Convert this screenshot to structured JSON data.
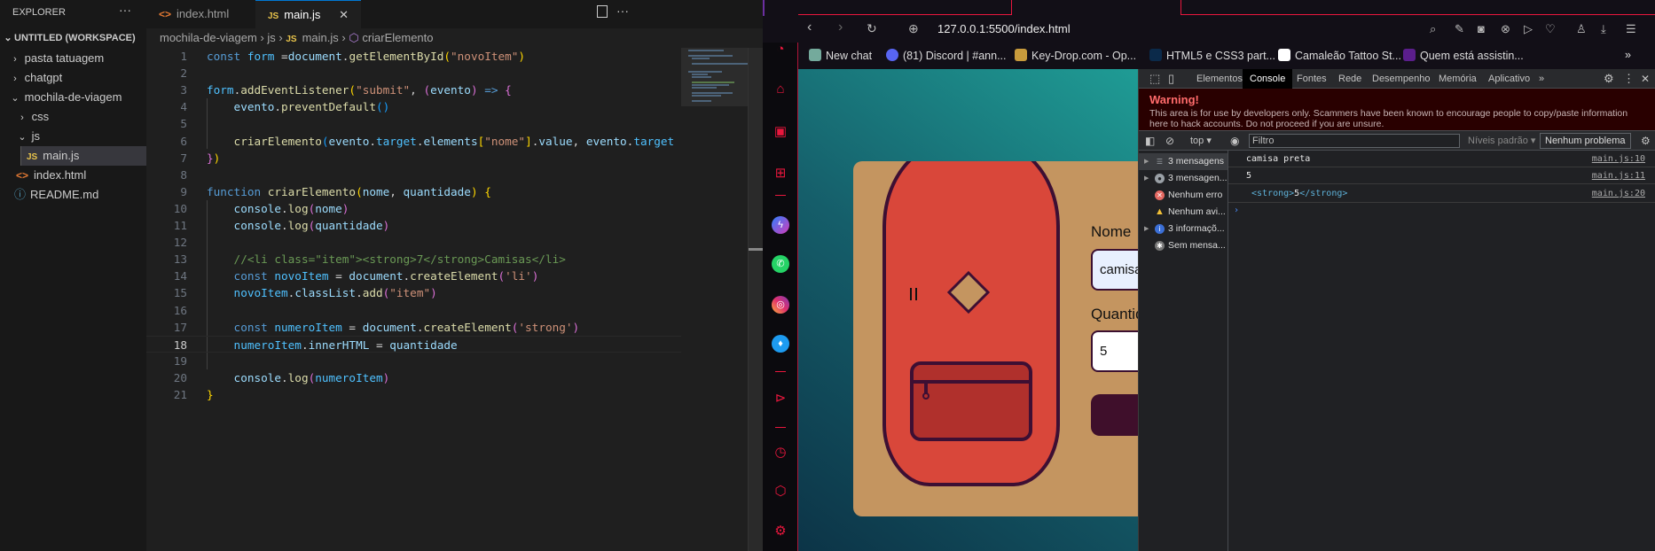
{
  "vscode": {
    "explorer": {
      "title": "EXPLORER",
      "more": "···",
      "workspace": "UNTITLED (WORKSPACE)",
      "items": [
        {
          "label": "pasta tatuagem",
          "chev": "›"
        },
        {
          "label": "chatgpt",
          "chev": "›"
        },
        {
          "label": "mochila-de-viagem",
          "chev": "⌄"
        },
        {
          "label": "css",
          "chev": "›"
        },
        {
          "label": "js",
          "chev": "⌄"
        },
        {
          "label": "main.js",
          "icon": "JS"
        },
        {
          "label": "index.html",
          "icon": "<>"
        },
        {
          "label": "README.md",
          "icon": "ⓘ"
        }
      ]
    },
    "tabs": [
      {
        "label": "index.html",
        "icon": "<>"
      },
      {
        "label": "main.js",
        "icon": "JS",
        "close": "✕"
      }
    ],
    "breadcrumb": [
      "mochila-de-viagem",
      "js",
      "main.js",
      "criarElemento"
    ],
    "current_line": 18,
    "code": [
      {
        "n": "1",
        "tokens": [
          [
            "const ",
            "k"
          ],
          [
            "form",
            "v2"
          ],
          [
            " =",
            "p"
          ],
          [
            "document",
            "v"
          ],
          [
            ".",
            "p"
          ],
          [
            "getElementById",
            "f"
          ],
          [
            "(",
            "b1"
          ],
          [
            "\"novoItem\"",
            "s"
          ],
          [
            ")",
            "b1"
          ]
        ]
      },
      {
        "n": "2",
        "tokens": []
      },
      {
        "n": "3",
        "tokens": [
          [
            "form",
            "v2"
          ],
          [
            ".",
            "p"
          ],
          [
            "addEventListener",
            "f"
          ],
          [
            "(",
            "b1"
          ],
          [
            "\"submit\"",
            "s"
          ],
          [
            ", ",
            "p"
          ],
          [
            "(",
            "b2"
          ],
          [
            "evento",
            "v"
          ],
          [
            ")",
            "b2"
          ],
          [
            " => ",
            "k"
          ],
          [
            "{",
            "b2"
          ]
        ]
      },
      {
        "n": "4",
        "tokens": [
          [
            "    evento",
            "v"
          ],
          [
            ".",
            "p"
          ],
          [
            "preventDefault",
            "f"
          ],
          [
            "()",
            "b3"
          ]
        ]
      },
      {
        "n": "5",
        "tokens": []
      },
      {
        "n": "6",
        "tokens": [
          [
            "    criarElemento",
            "f"
          ],
          [
            "(",
            "b3"
          ],
          [
            "evento",
            "v"
          ],
          [
            ".",
            "p"
          ],
          [
            "target",
            "v2"
          ],
          [
            ".",
            "p"
          ],
          [
            "elements",
            "v"
          ],
          [
            "[",
            "b1"
          ],
          [
            "\"nome\"",
            "s"
          ],
          [
            "]",
            "b1"
          ],
          [
            ".",
            "p"
          ],
          [
            "value",
            "v"
          ],
          [
            ", ",
            "p"
          ],
          [
            "evento",
            "v"
          ],
          [
            ".",
            "p"
          ],
          [
            "target",
            "v2"
          ]
        ]
      },
      {
        "n": "7",
        "tokens": [
          [
            "}",
            "b2"
          ],
          [
            ")",
            "b1"
          ]
        ]
      },
      {
        "n": "8",
        "tokens": []
      },
      {
        "n": "9",
        "tokens": [
          [
            "function ",
            "k"
          ],
          [
            "criarElemento",
            "f"
          ],
          [
            "(",
            "b1"
          ],
          [
            "nome",
            "v"
          ],
          [
            ", ",
            "p"
          ],
          [
            "quantidade",
            "v"
          ],
          [
            ")",
            "b1"
          ],
          [
            " ",
            "p"
          ],
          [
            "{",
            "b1"
          ]
        ]
      },
      {
        "n": "10",
        "tokens": [
          [
            "    console",
            "v"
          ],
          [
            ".",
            "p"
          ],
          [
            "log",
            "f"
          ],
          [
            "(",
            "b2"
          ],
          [
            "nome",
            "v"
          ],
          [
            ")",
            "b2"
          ]
        ]
      },
      {
        "n": "11",
        "tokens": [
          [
            "    console",
            "v"
          ],
          [
            ".",
            "p"
          ],
          [
            "log",
            "f"
          ],
          [
            "(",
            "b2"
          ],
          [
            "quantidade",
            "v"
          ],
          [
            ")",
            "b2"
          ]
        ]
      },
      {
        "n": "12",
        "tokens": []
      },
      {
        "n": "13",
        "tokens": [
          [
            "    //<li class=\"item\"><strong>7</strong>Camisas</li>",
            "c"
          ]
        ]
      },
      {
        "n": "14",
        "tokens": [
          [
            "    const ",
            "k"
          ],
          [
            "novoItem",
            "v2"
          ],
          [
            " = ",
            "p"
          ],
          [
            "document",
            "v"
          ],
          [
            ".",
            "p"
          ],
          [
            "createElement",
            "f"
          ],
          [
            "(",
            "b2"
          ],
          [
            "'li'",
            "s"
          ],
          [
            ")",
            "b2"
          ]
        ]
      },
      {
        "n": "15",
        "tokens": [
          [
            "    novoItem",
            "v2"
          ],
          [
            ".",
            "p"
          ],
          [
            "classList",
            "v"
          ],
          [
            ".",
            "p"
          ],
          [
            "add",
            "f"
          ],
          [
            "(",
            "b2"
          ],
          [
            "\"item\"",
            "s"
          ],
          [
            ")",
            "b2"
          ]
        ]
      },
      {
        "n": "16",
        "tokens": []
      },
      {
        "n": "17",
        "tokens": [
          [
            "    const ",
            "k"
          ],
          [
            "numeroItem",
            "v2"
          ],
          [
            " = ",
            "p"
          ],
          [
            "document",
            "v"
          ],
          [
            ".",
            "p"
          ],
          [
            "createElement",
            "f"
          ],
          [
            "(",
            "b2"
          ],
          [
            "'strong'",
            "s"
          ],
          [
            ")",
            "b2"
          ]
        ]
      },
      {
        "n": "18",
        "tokens": [
          [
            "    numeroItem",
            "v2"
          ],
          [
            ".",
            "p"
          ],
          [
            "innerHTML",
            "v"
          ],
          [
            " = ",
            "p"
          ],
          [
            "quantidade",
            "v"
          ]
        ]
      },
      {
        "n": "19",
        "tokens": []
      },
      {
        "n": "20",
        "tokens": [
          [
            "    console",
            "v"
          ],
          [
            ".",
            "p"
          ],
          [
            "log",
            "f"
          ],
          [
            "(",
            "b2"
          ],
          [
            "numeroItem",
            "v2"
          ],
          [
            ")",
            "b2"
          ]
        ]
      },
      {
        "n": "21",
        "tokens": [
          [
            "}",
            "b1"
          ]
        ]
      }
    ]
  },
  "browser": {
    "url": "127.0.0.1:5500/index.html",
    "bookmarks": [
      {
        "label": "New chat",
        "color": "#74aa9c"
      },
      {
        "label": "(81) Discord | #ann...",
        "color": "#5865f2"
      },
      {
        "label": "Key-Drop.com - Op...",
        "color": "#c89b3c"
      },
      {
        "label": "HTML5 e CSS3 part...",
        "color": "#0b2a4a"
      },
      {
        "label": "Camaleão Tattoo St...",
        "color": "#ffffff"
      },
      {
        "label": "Quem está assistin...",
        "color": "#5b1e8c"
      }
    ],
    "bookmarks_more": "»",
    "page": {
      "nome_label": "Nome",
      "nome_value": "camisa preta",
      "quantidade_label": "Quantidade",
      "quantidade_value": "5"
    }
  },
  "devtools": {
    "tabs": [
      "Elementos",
      "Console",
      "Fontes",
      "Rede",
      "Desempenho",
      "Memória",
      "Aplicativo"
    ],
    "active_tab": "Console",
    "more_tabs": "»",
    "warning_title": "Warning!",
    "warning_text": "This area is for use by developers only. Scammers have been known to encourage people to copy/paste information here to hack accounts. Do not proceed if you are unsure.",
    "context": "top ▾",
    "filter_placeholder": "Filtro",
    "levels": "Níveis padrão ▾",
    "issues": "Nenhum problema",
    "sidebar": [
      {
        "label": "3 mensagens",
        "icon": "list",
        "color": "#9aa0a6"
      },
      {
        "label": "3 mensagen...",
        "icon": "user",
        "color": "#9aa0a6"
      },
      {
        "label": "Nenhum erro",
        "icon": "error",
        "color": "#e46962"
      },
      {
        "label": "Nenhum avi...",
        "icon": "warning",
        "color": "#f2c037"
      },
      {
        "label": "3 informaçõ...",
        "icon": "info",
        "color": "#3b6fd6"
      },
      {
        "label": "Sem mensa...",
        "icon": "bug",
        "color": "#777777"
      }
    ],
    "messages": [
      {
        "text": "camisa preta",
        "source": "main.js:10"
      },
      {
        "text": "5",
        "source": "main.js:11"
      },
      {
        "tag_open": "<strong>",
        "inner": "5",
        "tag_close": "</strong>",
        "source": "main.js:20"
      }
    ],
    "prompt": "›"
  }
}
